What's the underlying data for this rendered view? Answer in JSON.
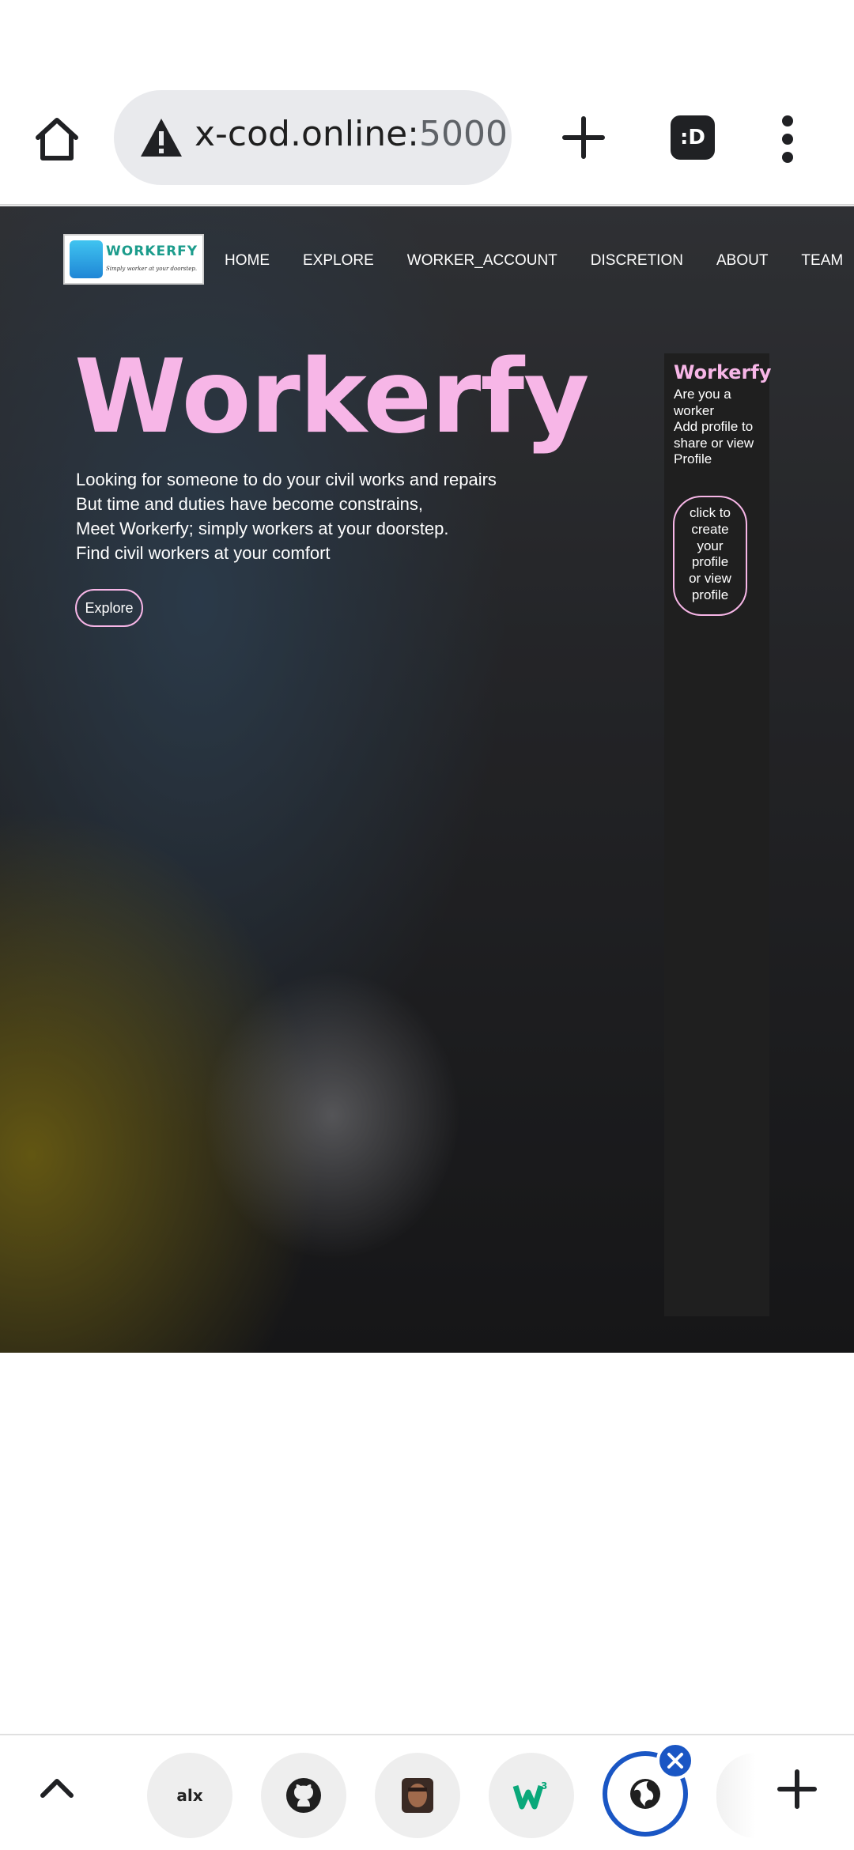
{
  "browser": {
    "url_main": "x-cod.online:",
    "url_port": "5000",
    "tabs_button_label": ":D",
    "icons": [
      "home-icon",
      "warning-icon",
      "plus-icon",
      "tabs-icon",
      "more-vert-icon"
    ]
  },
  "site": {
    "logo": {
      "word": "WORKERFY",
      "tagline": "Simply worker at your doorstep."
    },
    "nav": [
      "HOME",
      "EXPLORE",
      "WORKER_ACCOUNT",
      "DISCRETION",
      "ABOUT",
      "TEAM"
    ],
    "hero": {
      "title": "Workerfy",
      "lines": [
        "Looking for someone to do your civil works and repairs",
        "But time and duties have become constrains,",
        "Meet Workerfy; simply workers at your doorstep.",
        "Find civil workers at your comfort"
      ],
      "explore_label": "Explore"
    },
    "side_panel": {
      "title": "Workerfy",
      "text_lines": [
        "Are you a",
        "worker",
        "Add profile to",
        "share or view",
        "Profile"
      ],
      "button_lines": [
        "click to",
        "create",
        "your",
        "profile",
        "or view",
        "profile"
      ]
    },
    "colors": {
      "accent_pink": "#f7b6e7",
      "panel_bg": "#1f1f1f"
    }
  },
  "bottom_tabs": {
    "chips": [
      {
        "name": "alx-tab",
        "label": "alx"
      },
      {
        "name": "github-tab",
        "icon": "github-icon"
      },
      {
        "name": "avatar-tab",
        "icon": "avatar-photo"
      },
      {
        "name": "w3-tab",
        "icon": "w3-logo-icon"
      },
      {
        "name": "globe-tab",
        "icon": "globe-icon",
        "active": true
      }
    ],
    "icons": [
      "caret-up-icon",
      "close-icon",
      "new-tab-plus-icon"
    ]
  }
}
